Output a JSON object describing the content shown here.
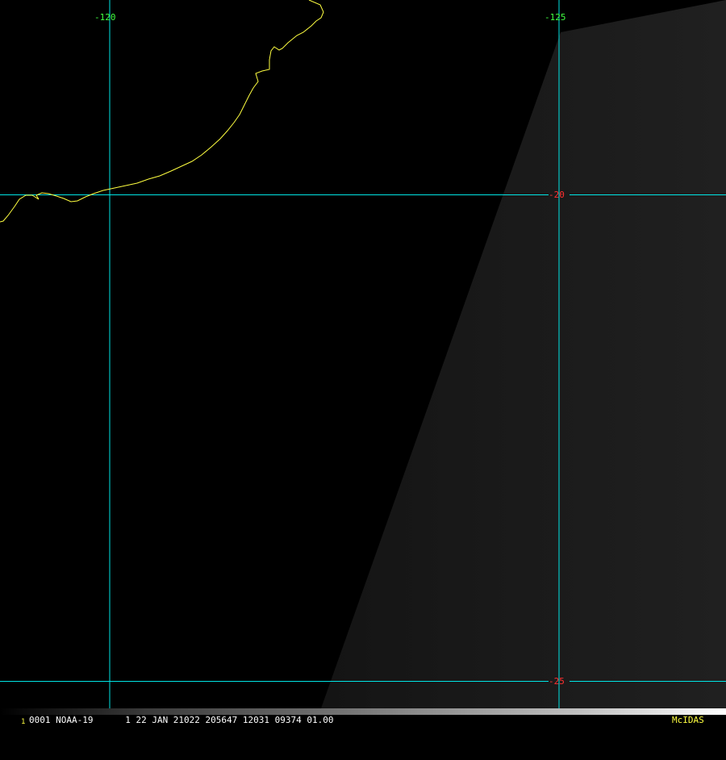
{
  "map": {
    "colors": {
      "background": "#000000",
      "swath": "#1b1b1b",
      "grid": "#00e5e5",
      "coastline": "#ffff40",
      "lon_label": "#40ff40",
      "lat_label": "#ff3030",
      "status_text": "#ffffff",
      "frame_number": "#ffff40",
      "brand": "#ffff40"
    },
    "longitude_labels": [
      "-120",
      "-125"
    ],
    "latitude_labels": [
      "-20",
      "-25"
    ]
  },
  "status_bar": {
    "frame_number": "1",
    "image_info": "0001 NOAA-19      1 22 JAN 21022 205647 12031 09374 01.00",
    "brand": "McIDAS"
  }
}
